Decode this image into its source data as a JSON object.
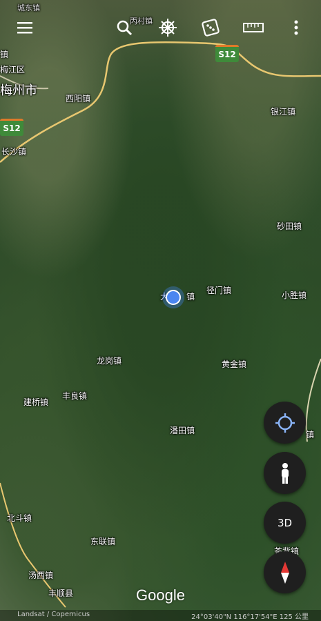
{
  "top_labels": {
    "town_top_left": "城东镇",
    "town_top_center": "丙村镇"
  },
  "toolbar": {
    "menu_icon": "hamburger-menu-icon",
    "search_icon": "search-icon",
    "voyager_icon": "ships-wheel-icon",
    "feeling_lucky_icon": "dice-icon",
    "measure_icon": "ruler-icon",
    "more_icon": "more-vertical-icon"
  },
  "road_shields": [
    "S12",
    "S12"
  ],
  "place_labels": {
    "zhen_left_top": "镇",
    "district": "梅江区",
    "city": "梅州市",
    "xiyang": "西阳镇",
    "yinjiang": "银江镇",
    "changsha": "长沙镇",
    "shatian": "砂田镇",
    "jingmen": "径门镇",
    "dapu_partial": "大",
    "dapu_suffix": "镇",
    "xiaosheng": "小胜镇",
    "longgang": "龙岗镇",
    "huangjin": "黄金镇",
    "fengliang": "丰良镇",
    "jianqiao": "建桥镇",
    "pantian": "潘田镇",
    "right_edge": "镇",
    "beidou": "北斗镇",
    "donglian": "东联镇",
    "chabei": "茶背镇",
    "tangxi": "汤西镇",
    "fengshun": "丰顺县"
  },
  "controls": {
    "my_location_icon": "crosshair-location-icon",
    "street_view_icon": "pegman-icon",
    "view_3d_label": "3D",
    "compass_icon": "compass-icon"
  },
  "branding": {
    "logo": "Google"
  },
  "footer": {
    "attribution": "Landsat / Copernicus",
    "coordinates": "24°03'40\"N 116°17'54\"E 125 公里"
  },
  "colors": {
    "road": "#e8c770",
    "shield_bg": "#3f8a3a",
    "shield_top": "#e07a2a",
    "location_dot": "#4a86f0"
  }
}
